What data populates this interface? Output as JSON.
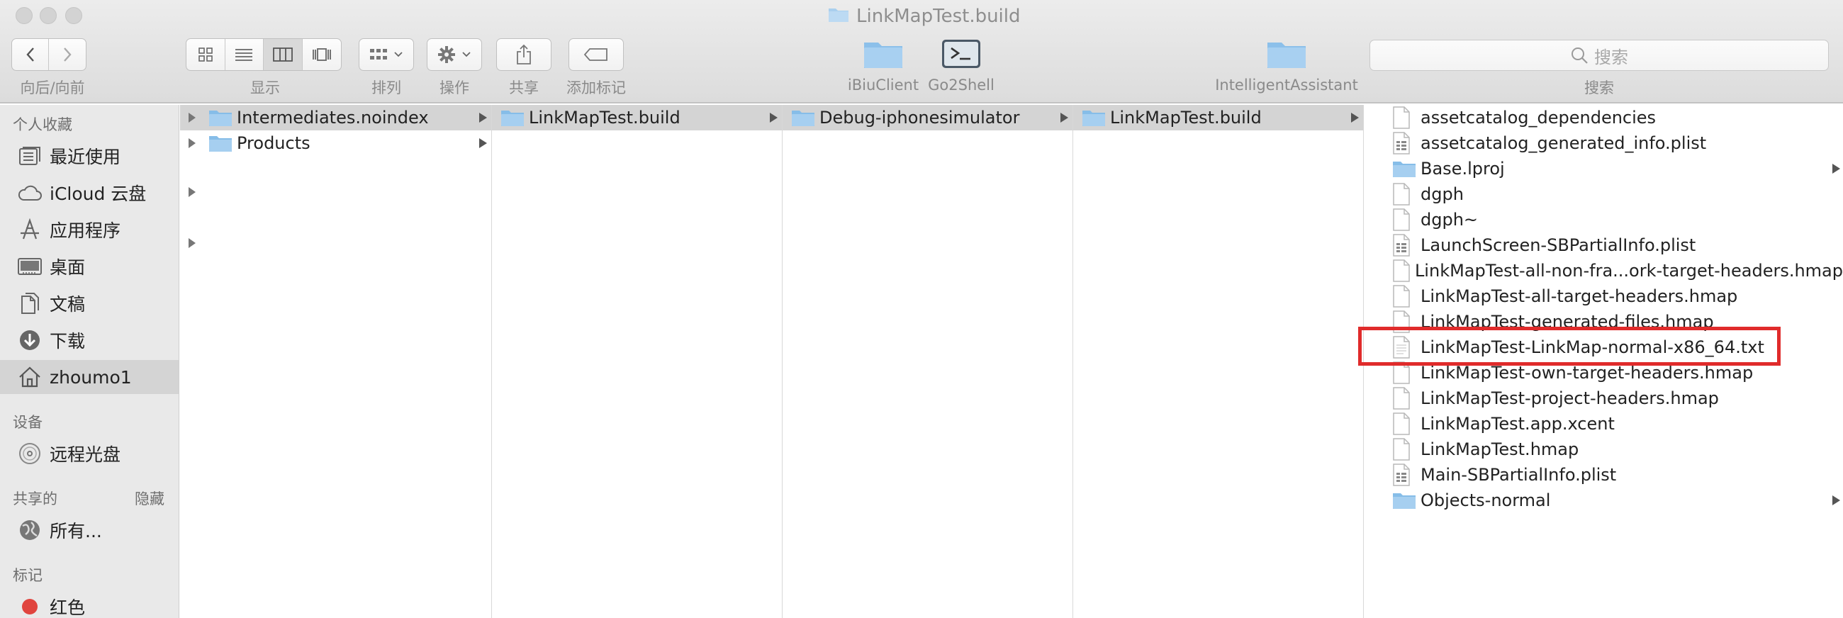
{
  "window": {
    "title": "LinkMapTest.build"
  },
  "toolbar": {
    "nav_label": "向后/向前",
    "view_label": "显示",
    "arrange_label": "排列",
    "action_label": "操作",
    "share_label": "共享",
    "tags_label": "添加标记",
    "search_label": "搜索",
    "search_placeholder": "搜索",
    "favorites": [
      {
        "label": "iBiuClient",
        "icon": "folder-icon"
      },
      {
        "label": "Go2Shell",
        "icon": "terminal-icon"
      },
      {
        "label": "IntelligentAssistant",
        "icon": "folder-icon"
      }
    ]
  },
  "sidebar": {
    "favorites_header": "个人收藏",
    "favorites": [
      {
        "label": "最近使用",
        "icon": "recents-icon"
      },
      {
        "label": "iCloud 云盘",
        "icon": "cloud-icon"
      },
      {
        "label": "应用程序",
        "icon": "applications-icon"
      },
      {
        "label": "桌面",
        "icon": "desktop-icon"
      },
      {
        "label": "文稿",
        "icon": "documents-icon"
      },
      {
        "label": "下载",
        "icon": "downloads-icon"
      },
      {
        "label": "zhoumo1",
        "icon": "home-icon"
      }
    ],
    "devices_header": "设备",
    "devices": [
      {
        "label": "远程光盘",
        "icon": "disc-icon"
      }
    ],
    "shared_header": "共享的",
    "shared_hide": "隐藏",
    "shared": [
      {
        "label": "所有...",
        "icon": "network-icon"
      }
    ],
    "tags_header": "标记",
    "tags": [
      {
        "label": "红色",
        "color": "#e0443e"
      }
    ]
  },
  "columns": [
    {
      "items": [
        {
          "name": "Intermediates.noindex",
          "type": "folder",
          "selected": true,
          "has_children": true
        },
        {
          "name": "Products",
          "type": "folder",
          "selected": false,
          "has_children": true
        }
      ]
    },
    {
      "items": [
        {
          "name": "LinkMapTest.build",
          "type": "folder",
          "selected": true,
          "has_children": true
        }
      ]
    },
    {
      "items": [
        {
          "name": "Debug-iphonesimulator",
          "type": "folder",
          "selected": true,
          "has_children": true
        }
      ]
    },
    {
      "items": [
        {
          "name": "LinkMapTest.build",
          "type": "folder",
          "selected": true,
          "has_children": true
        }
      ]
    },
    {
      "items": [
        {
          "name": "assetcatalog_dependencies",
          "type": "file"
        },
        {
          "name": "assetcatalog_generated_info.plist",
          "type": "plist"
        },
        {
          "name": "Base.lproj",
          "type": "folder",
          "has_children": true
        },
        {
          "name": "dgph",
          "type": "file"
        },
        {
          "name": "dgph~",
          "type": "file"
        },
        {
          "name": "LaunchScreen-SBPartialInfo.plist",
          "type": "plist"
        },
        {
          "name": "LinkMapTest-all-non-fra...ork-target-headers.hmap",
          "type": "file"
        },
        {
          "name": "LinkMapTest-all-target-headers.hmap",
          "type": "file"
        },
        {
          "name": "LinkMapTest-generated-files.hmap",
          "type": "file"
        },
        {
          "name": "LinkMapTest-LinkMap-normal-x86_64.txt",
          "type": "text",
          "highlighted": true
        },
        {
          "name": "LinkMapTest-own-target-headers.hmap",
          "type": "file"
        },
        {
          "name": "LinkMapTest-project-headers.hmap",
          "type": "file"
        },
        {
          "name": "LinkMapTest.app.xcent",
          "type": "file"
        },
        {
          "name": "LinkMapTest.hmap",
          "type": "file"
        },
        {
          "name": "Main-SBPartialInfo.plist",
          "type": "plist"
        },
        {
          "name": "Objects-normal",
          "type": "folder",
          "has_children": true
        }
      ]
    }
  ],
  "highlight_color": "#e02b2b"
}
